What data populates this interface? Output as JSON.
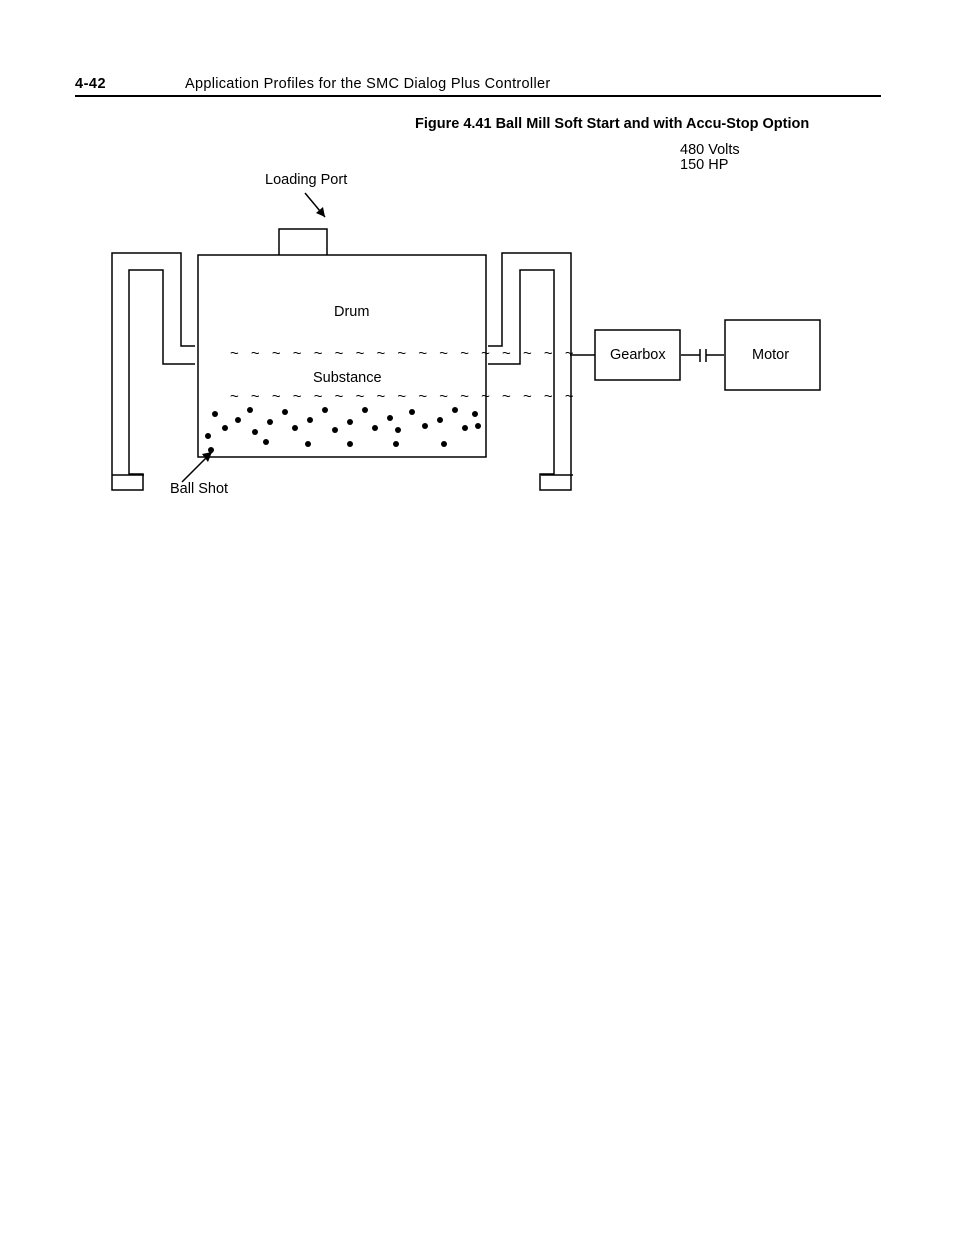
{
  "header": {
    "page_number": "4-42",
    "title": "Application Profiles for the SMC Dialog Plus Controller"
  },
  "figure": {
    "caption": "Figure 4.41 Ball Mill Soft Start and with Accu-Stop Option",
    "spec_volts": "480 Volts",
    "spec_hp": "150 HP"
  },
  "labels": {
    "loading_port": "Loading Port",
    "drum": "Drum",
    "substance": "Substance",
    "ball_shot": "Ball Shot",
    "gearbox": "Gearbox",
    "motor": "Motor"
  },
  "waves": {
    "row": "~ ~ ~ ~ ~ ~ ~ ~ ~ ~ ~ ~ ~ ~ ~ ~ ~"
  }
}
